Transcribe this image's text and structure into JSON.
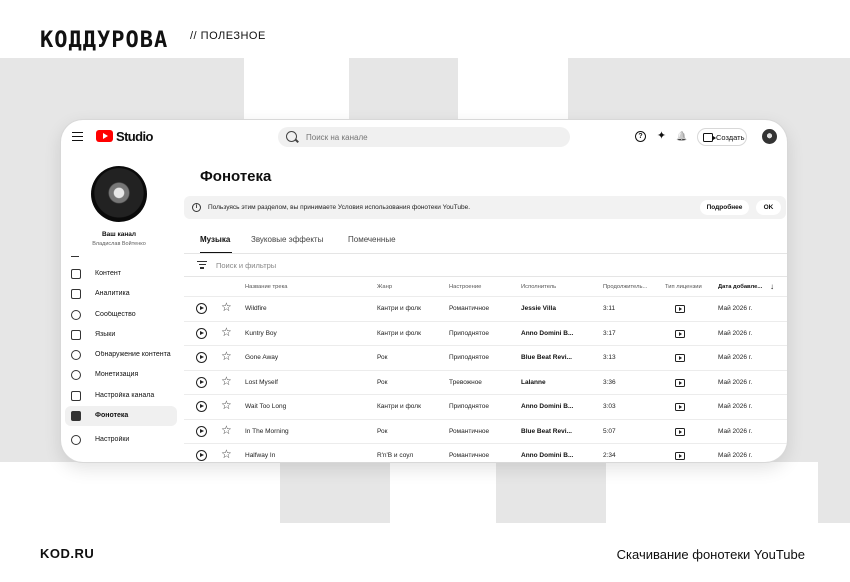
{
  "brand": {
    "logo_text": "КОДДУРОВА",
    "section": "// ПОЛЕЗНОЕ"
  },
  "footer": {
    "site": "KOD.RU",
    "caption": "Скачивание фонотеки YouTube"
  },
  "topbar": {
    "logo_text": "Studio",
    "search_placeholder": "Поиск на канале",
    "help_glyph": "?",
    "spark_glyph": "✦",
    "bell_glyph": "🔔",
    "create_label": "Создать"
  },
  "channel": {
    "label": "Ваш канал",
    "name": "Владислав Войтенко"
  },
  "sidebar": {
    "items": [
      {
        "label": "Контент",
        "active": false
      },
      {
        "label": "Аналитика",
        "active": false
      },
      {
        "label": "Сообщество",
        "active": false
      },
      {
        "label": "Языки",
        "active": false
      },
      {
        "label": "Обнаружение контента",
        "active": false
      },
      {
        "label": "Монетизация",
        "active": false
      },
      {
        "label": "Настройка канала",
        "active": false
      },
      {
        "label": "Фонотека",
        "active": true
      },
      {
        "label": "Настройки",
        "active": false
      }
    ]
  },
  "main": {
    "title": "Фонотека",
    "notice": {
      "text": "Пользуясь этим разделом, вы принимаете Условия использования фонотеки YouTube.",
      "more_label": "Подробнее",
      "ok_label": "OK"
    },
    "tabs": [
      "Музыка",
      "Звуковые эффекты",
      "Помеченные"
    ],
    "active_tab": "Музыка",
    "filter_placeholder": "Поиск и фильтры",
    "columns": {
      "title": "Название трека",
      "genre": "Жанр",
      "mood": "Настроение",
      "artist": "Исполнитель",
      "duration": "Продолжитель...",
      "license": "Тип лицензии",
      "date": "Дата добавле..."
    },
    "sort_glyph": "↓",
    "tracks": [
      {
        "title": "Wildfire",
        "genre": "Кантри и фолк",
        "mood": "Романтичное",
        "artist": "Jessie Villa",
        "duration": "3:11",
        "date": "Май 2026 г."
      },
      {
        "title": "Kuntry Boy",
        "genre": "Кантри и фолк",
        "mood": "Приподнятое",
        "artist": "Anno Domini B...",
        "duration": "3:17",
        "date": "Май 2026 г."
      },
      {
        "title": "Gone Away",
        "genre": "Рок",
        "mood": "Приподнятое",
        "artist": "Blue Beat Revi...",
        "duration": "3:13",
        "date": "Май 2026 г."
      },
      {
        "title": "Lost Myself",
        "genre": "Рок",
        "mood": "Тревожное",
        "artist": "Lalanne",
        "duration": "3:36",
        "date": "Май 2026 г."
      },
      {
        "title": "Wait Too Long",
        "genre": "Кантри и фолк",
        "mood": "Приподнятое",
        "artist": "Anno Domini B...",
        "duration": "3:03",
        "date": "Май 2026 г."
      },
      {
        "title": "In The Morning",
        "genre": "Рок",
        "mood": "Романтичное",
        "artist": "Blue Beat Revi...",
        "duration": "5:07",
        "date": "Май 2026 г."
      },
      {
        "title": "Halfway In",
        "genre": "R'n'B и соул",
        "mood": "Романтичное",
        "artist": "Anno Domini B...",
        "duration": "2:34",
        "date": "Май 2026 г."
      }
    ]
  }
}
